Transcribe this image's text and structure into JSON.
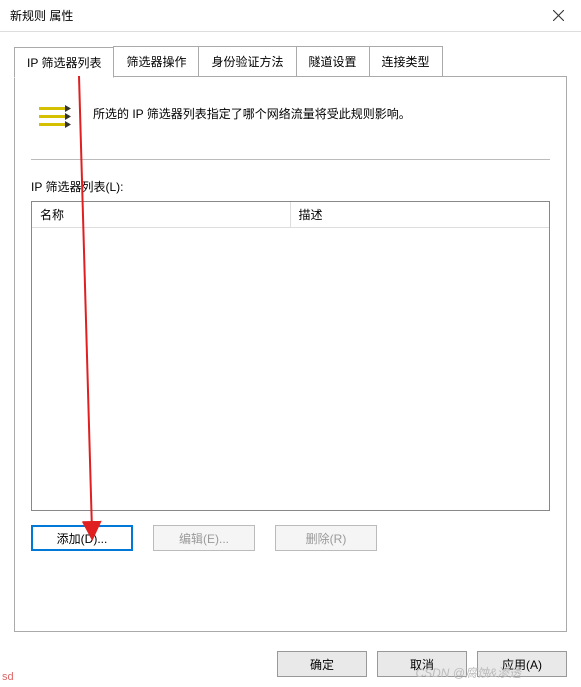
{
  "titlebar": {
    "title": "新规则 属性"
  },
  "tabs": {
    "items": [
      {
        "label": "IP 筛选器列表"
      },
      {
        "label": "筛选器操作"
      },
      {
        "label": "身份验证方法"
      },
      {
        "label": "隧道设置"
      },
      {
        "label": "连接类型"
      }
    ],
    "active_index": 0
  },
  "info": {
    "text": "所选的 IP 筛选器列表指定了哪个网络流量将受此规则影响。"
  },
  "list": {
    "label": "IP 筛选器列表(L):",
    "columns": {
      "name": "名称",
      "desc": "描述"
    },
    "rows": []
  },
  "buttons": {
    "add": "添加(D)...",
    "edit": "编辑(E)...",
    "remove": "删除(R)"
  },
  "footer": {
    "ok": "确定",
    "cancel": "取消",
    "apply": "应用(A)"
  },
  "misc": {
    "sd": "sd",
    "watermark": "CSDN @腐蚀&渗透"
  }
}
